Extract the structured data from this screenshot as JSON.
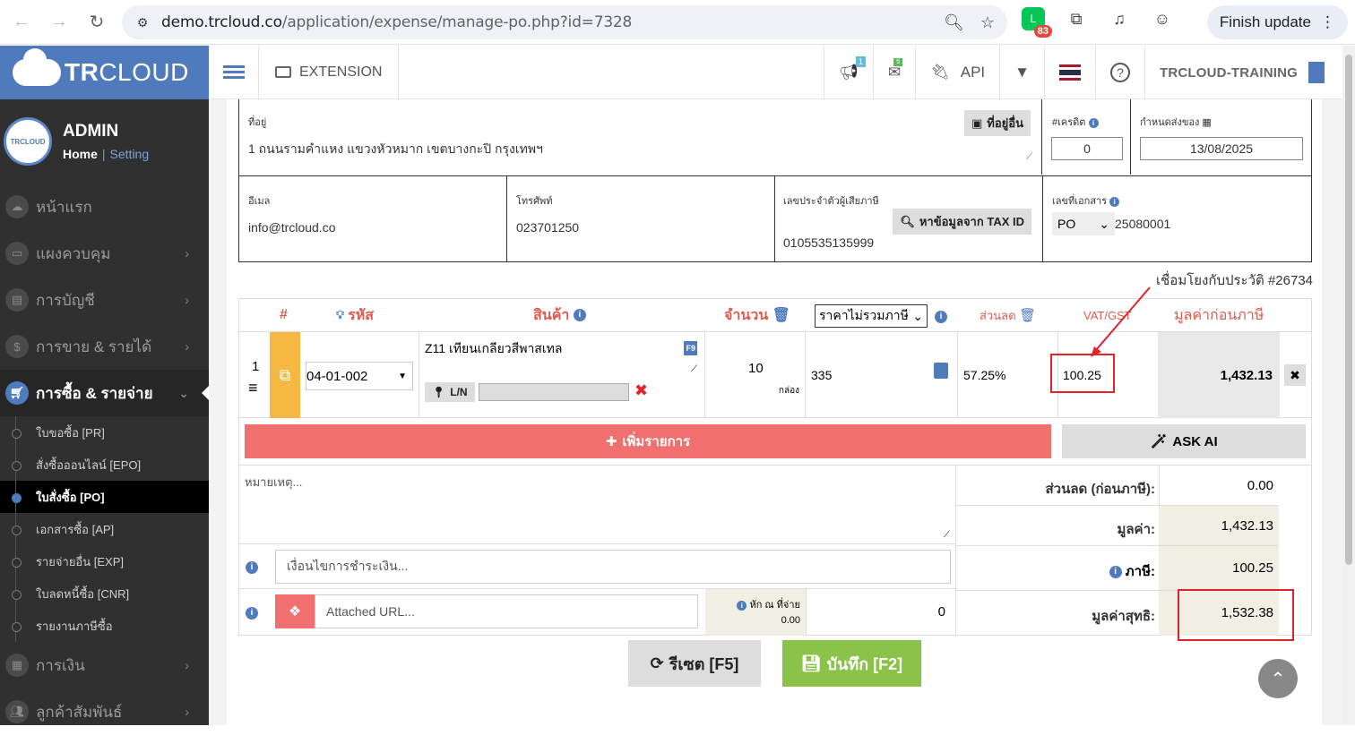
{
  "browser": {
    "url_host": "demo.trcloud.co",
    "url_path": "/application/expense/manage-po.php?id=7328",
    "ext_badge": "83",
    "finish_update": "Finish update"
  },
  "sidebar": {
    "logo_tr": "TR",
    "logo_cloud": "CLOUD",
    "avatar_text": "TRCLOUD",
    "user_name": "ADMIN",
    "home": "Home",
    "setting": "Setting",
    "menu": [
      {
        "label": "หน้าแรก",
        "icon": "cloud-icon"
      },
      {
        "label": "แผงควบคุม",
        "icon": "monitor-icon"
      },
      {
        "label": "การบัญชี",
        "icon": "book-icon"
      },
      {
        "label": "การขาย & รายได้",
        "icon": "dollar-icon"
      },
      {
        "label": "การซื้อ & รายจ่าย",
        "icon": "cart-icon"
      }
    ],
    "submenu": [
      "ใบขอซื้อ [PR]",
      "สั่งซื้อออนไลน์ [EPO]",
      "ใบสั่งซื้อ [PO]",
      "เอกสารซื้อ [AP]",
      "รายจ่ายอื่น [EXP]",
      "ใบลดหนี้ซื้อ [CNR]",
      "รายงานภาษีซื้อ"
    ],
    "menu_after": [
      {
        "label": "การเงิน",
        "icon": "calendar-icon"
      },
      {
        "label": "ลูกค้าสัมพันธ์",
        "icon": "users-icon"
      }
    ]
  },
  "topnav": {
    "extension": "EXTENSION",
    "notif_badge": "1",
    "mail_badge": "5",
    "api": "API",
    "company": "TRCLOUD-TRAINING"
  },
  "form": {
    "address_label": "ที่อยู่",
    "address_value": "1 ถนนรามคำแหง แขวงหัวหมาก เขตบางกะปิ กรุงเทพฯ",
    "other_address_btn": "ที่อยู่อื่น",
    "credit_label": "#เครดิต",
    "credit_value": "0",
    "delivery_label": "กำหนดส่งของ",
    "delivery_value": "13/08/2025",
    "email_label": "อีเมล",
    "email_value": "info@trcloud.co",
    "phone_label": "โทรศัพท์",
    "phone_value": "023701250",
    "taxid_label": "เลขประจำตัวผู้เสียภาษี",
    "taxid_btn": "หาข้อมูลจาก TAX ID",
    "taxid_value": "0105535135999",
    "docno_label": "เลขที่เอกสาร",
    "doc_prefix": "PO",
    "doc_number": "25080001",
    "history_link": "เชื่อมโยงกับประวัติ #26734"
  },
  "items_table": {
    "headers": {
      "num": "#",
      "code": "รหัส",
      "product": "สินค้า",
      "qty": "จำนวน",
      "price_mode": "ราคาไม่รวมภาษี",
      "discount": "ส่วนลด",
      "vat": "VAT/GST",
      "pre_tax": "มูลค่าก่อนภาษี"
    },
    "rows": [
      {
        "no": "1",
        "code": "04-01-002",
        "product": "Z11 เทียนเกลียวสีพาสเทล",
        "f9": "F9",
        "ln": "L/N",
        "qty": "10",
        "unit": "กล่อง",
        "price": "335",
        "discount": "57.25%",
        "vat": "100.25",
        "pre_tax": "1,432.13"
      }
    ],
    "add_item": "เพิ่มรายการ",
    "ask_ai": "ASK AI"
  },
  "footer": {
    "remark_placeholder": "หมายเหตุ...",
    "payment_placeholder": "เงื่อนไขการชำระเงิน...",
    "attached_placeholder": "Attached URL...",
    "withholding_label": "หัก ณ ที่จ่าย",
    "withholding_value": "0.00",
    "withholding_amount": "0",
    "summary": [
      {
        "label": "ส่วนลด (ก่อนภาษี):",
        "value": "0.00"
      },
      {
        "label": "มูลค่า:",
        "value": "1,432.13"
      },
      {
        "label": "ภาษี:",
        "value": "100.25"
      },
      {
        "label": "มูลค่าสุทธิ:",
        "value": "1,532.38"
      }
    ],
    "reset_btn": "รีเซต [F5]",
    "save_btn": "บันทึก [F2]"
  },
  "colors": {
    "brand_blue": "#4f7bbd",
    "add_red": "#f07070",
    "save_green": "#8bc34a",
    "highlight_red": "#e0232a",
    "code_yellow": "#f5b942"
  }
}
